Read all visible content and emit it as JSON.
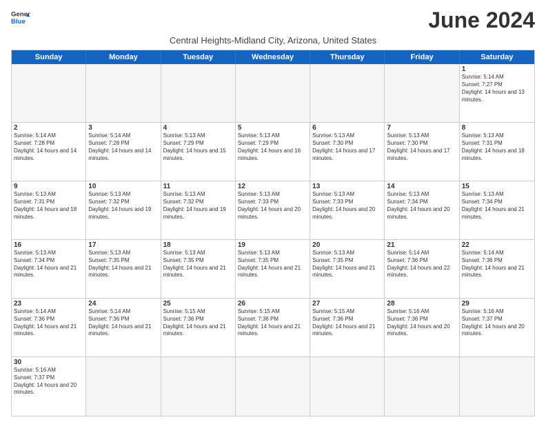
{
  "header": {
    "logo_line1": "General",
    "logo_line2": "Blue",
    "month_title": "June 2024",
    "subtitle": "Central Heights-Midland City, Arizona, United States"
  },
  "days": [
    "Sunday",
    "Monday",
    "Tuesday",
    "Wednesday",
    "Thursday",
    "Friday",
    "Saturday"
  ],
  "cells": [
    {
      "day": null,
      "empty": true
    },
    {
      "day": null,
      "empty": true
    },
    {
      "day": null,
      "empty": true
    },
    {
      "day": null,
      "empty": true
    },
    {
      "day": null,
      "empty": true
    },
    {
      "day": null,
      "empty": true
    },
    {
      "day": "1",
      "sunrise": "Sunrise: 5:14 AM",
      "sunset": "Sunset: 7:27 PM",
      "daylight": "Daylight: 14 hours and 13 minutes."
    },
    {
      "day": "2",
      "sunrise": "Sunrise: 5:14 AM",
      "sunset": "Sunset: 7:28 PM",
      "daylight": "Daylight: 14 hours and 14 minutes."
    },
    {
      "day": "3",
      "sunrise": "Sunrise: 5:14 AM",
      "sunset": "Sunset: 7:28 PM",
      "daylight": "Daylight: 14 hours and 14 minutes."
    },
    {
      "day": "4",
      "sunrise": "Sunrise: 5:13 AM",
      "sunset": "Sunset: 7:29 PM",
      "daylight": "Daylight: 14 hours and 15 minutes."
    },
    {
      "day": "5",
      "sunrise": "Sunrise: 5:13 AM",
      "sunset": "Sunset: 7:29 PM",
      "daylight": "Daylight: 14 hours and 16 minutes."
    },
    {
      "day": "6",
      "sunrise": "Sunrise: 5:13 AM",
      "sunset": "Sunset: 7:30 PM",
      "daylight": "Daylight: 14 hours and 17 minutes."
    },
    {
      "day": "7",
      "sunrise": "Sunrise: 5:13 AM",
      "sunset": "Sunset: 7:30 PM",
      "daylight": "Daylight: 14 hours and 17 minutes."
    },
    {
      "day": "8",
      "sunrise": "Sunrise: 5:13 AM",
      "sunset": "Sunset: 7:31 PM",
      "daylight": "Daylight: 14 hours and 18 minutes."
    },
    {
      "day": "9",
      "sunrise": "Sunrise: 5:13 AM",
      "sunset": "Sunset: 7:31 PM",
      "daylight": "Daylight: 14 hours and 18 minutes."
    },
    {
      "day": "10",
      "sunrise": "Sunrise: 5:13 AM",
      "sunset": "Sunset: 7:32 PM",
      "daylight": "Daylight: 14 hours and 19 minutes."
    },
    {
      "day": "11",
      "sunrise": "Sunrise: 5:13 AM",
      "sunset": "Sunset: 7:32 PM",
      "daylight": "Daylight: 14 hours and 19 minutes."
    },
    {
      "day": "12",
      "sunrise": "Sunrise: 5:13 AM",
      "sunset": "Sunset: 7:33 PM",
      "daylight": "Daylight: 14 hours and 20 minutes."
    },
    {
      "day": "13",
      "sunrise": "Sunrise: 5:13 AM",
      "sunset": "Sunset: 7:33 PM",
      "daylight": "Daylight: 14 hours and 20 minutes."
    },
    {
      "day": "14",
      "sunrise": "Sunrise: 5:13 AM",
      "sunset": "Sunset: 7:34 PM",
      "daylight": "Daylight: 14 hours and 20 minutes."
    },
    {
      "day": "15",
      "sunrise": "Sunrise: 5:13 AM",
      "sunset": "Sunset: 7:34 PM",
      "daylight": "Daylight: 14 hours and 21 minutes."
    },
    {
      "day": "16",
      "sunrise": "Sunrise: 5:13 AM",
      "sunset": "Sunset: 7:34 PM",
      "daylight": "Daylight: 14 hours and 21 minutes."
    },
    {
      "day": "17",
      "sunrise": "Sunrise: 5:13 AM",
      "sunset": "Sunset: 7:35 PM",
      "daylight": "Daylight: 14 hours and 21 minutes."
    },
    {
      "day": "18",
      "sunrise": "Sunrise: 5:13 AM",
      "sunset": "Sunset: 7:35 PM",
      "daylight": "Daylight: 14 hours and 21 minutes."
    },
    {
      "day": "19",
      "sunrise": "Sunrise: 5:13 AM",
      "sunset": "Sunset: 7:35 PM",
      "daylight": "Daylight: 14 hours and 21 minutes."
    },
    {
      "day": "20",
      "sunrise": "Sunrise: 5:13 AM",
      "sunset": "Sunset: 7:35 PM",
      "daylight": "Daylight: 14 hours and 21 minutes."
    },
    {
      "day": "21",
      "sunrise": "Sunrise: 5:14 AM",
      "sunset": "Sunset: 7:36 PM",
      "daylight": "Daylight: 14 hours and 22 minutes."
    },
    {
      "day": "22",
      "sunrise": "Sunrise: 5:14 AM",
      "sunset": "Sunset: 7:36 PM",
      "daylight": "Daylight: 14 hours and 21 minutes."
    },
    {
      "day": "23",
      "sunrise": "Sunrise: 5:14 AM",
      "sunset": "Sunset: 7:36 PM",
      "daylight": "Daylight: 14 hours and 21 minutes."
    },
    {
      "day": "24",
      "sunrise": "Sunrise: 5:14 AM",
      "sunset": "Sunset: 7:36 PM",
      "daylight": "Daylight: 14 hours and 21 minutes."
    },
    {
      "day": "25",
      "sunrise": "Sunrise: 5:15 AM",
      "sunset": "Sunset: 7:36 PM",
      "daylight": "Daylight: 14 hours and 21 minutes."
    },
    {
      "day": "26",
      "sunrise": "Sunrise: 5:15 AM",
      "sunset": "Sunset: 7:36 PM",
      "daylight": "Daylight: 14 hours and 21 minutes."
    },
    {
      "day": "27",
      "sunrise": "Sunrise: 5:15 AM",
      "sunset": "Sunset: 7:36 PM",
      "daylight": "Daylight: 14 hours and 21 minutes."
    },
    {
      "day": "28",
      "sunrise": "Sunrise: 5:16 AM",
      "sunset": "Sunset: 7:36 PM",
      "daylight": "Daylight: 14 hours and 20 minutes."
    },
    {
      "day": "29",
      "sunrise": "Sunrise: 5:16 AM",
      "sunset": "Sunset: 7:37 PM",
      "daylight": "Daylight: 14 hours and 20 minutes."
    },
    {
      "day": "30",
      "sunrise": "Sunrise: 5:16 AM",
      "sunset": "Sunset: 7:37 PM",
      "daylight": "Daylight: 14 hours and 20 minutes."
    },
    {
      "day": null,
      "empty": true
    },
    {
      "day": null,
      "empty": true
    },
    {
      "day": null,
      "empty": true
    },
    {
      "day": null,
      "empty": true
    },
    {
      "day": null,
      "empty": true
    },
    {
      "day": null,
      "empty": true
    }
  ]
}
